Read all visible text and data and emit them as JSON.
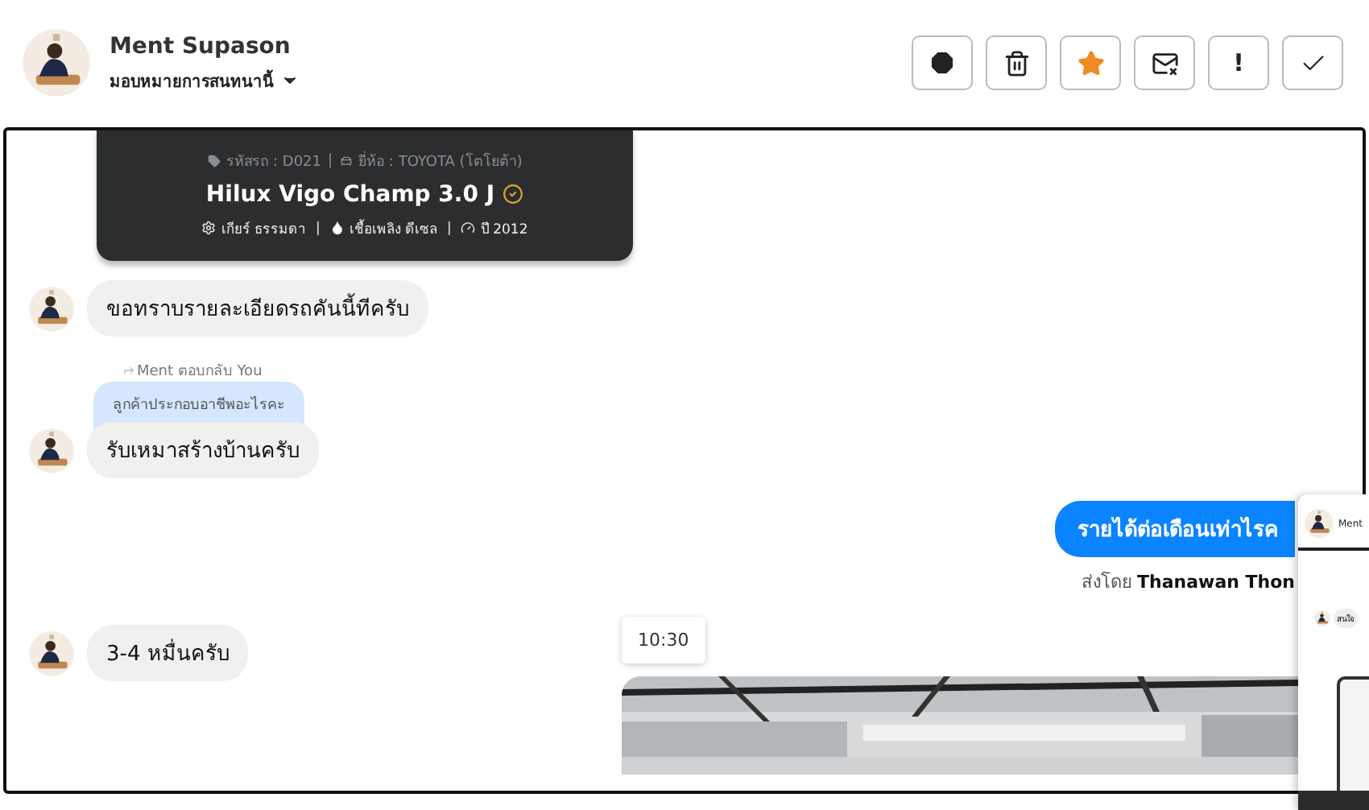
{
  "header": {
    "name": "Ment Supason",
    "assign_label": "มอบหมายการสนทนานี้",
    "actions": [
      {
        "kind": "icon"
      },
      {
        "kind": "icon"
      },
      {
        "kind": "icon"
      },
      {
        "kind": "icon"
      },
      {
        "kind": "text",
        "label": "!"
      },
      {
        "kind": "icon"
      }
    ]
  },
  "car_card": {
    "code": "รหัสรถ : D021",
    "separator": "|",
    "brand": "ยี่ห้อ : TOYOTA (โตโยต้า)",
    "model": "Hilux Vigo Champ 3.0 J",
    "verified": true,
    "specs": [
      {
        "text": "เกียร์ ธรรมดา"
      },
      {
        "text": "เชื้อเพลิง ดีเซล"
      },
      {
        "text": "ปี 2012"
      }
    ]
  },
  "messages": [
    {
      "kind": "incoming",
      "text": "ขอทราบรายละเอียดรถคันนี้ทีครับ"
    },
    {
      "kind": "reply",
      "reply_label": "Ment ตอบกลับ You",
      "quoted": "ลูกค้าประกอบอาชีพอะไรคะ",
      "text": "รับเหมาสร้างบ้านครับ"
    },
    {
      "kind": "outgoing",
      "text": "รายได้ต่อเดือนเท่าไรค",
      "sent_by_label": "ส่งโดย",
      "sender": "Thanawan Thon"
    },
    {
      "kind": "incoming_with_photo",
      "text": "3-4 หมื่นครับ",
      "time": "10:30"
    }
  ],
  "popup": {
    "name": "Ment",
    "preview": "สนใจ"
  }
}
